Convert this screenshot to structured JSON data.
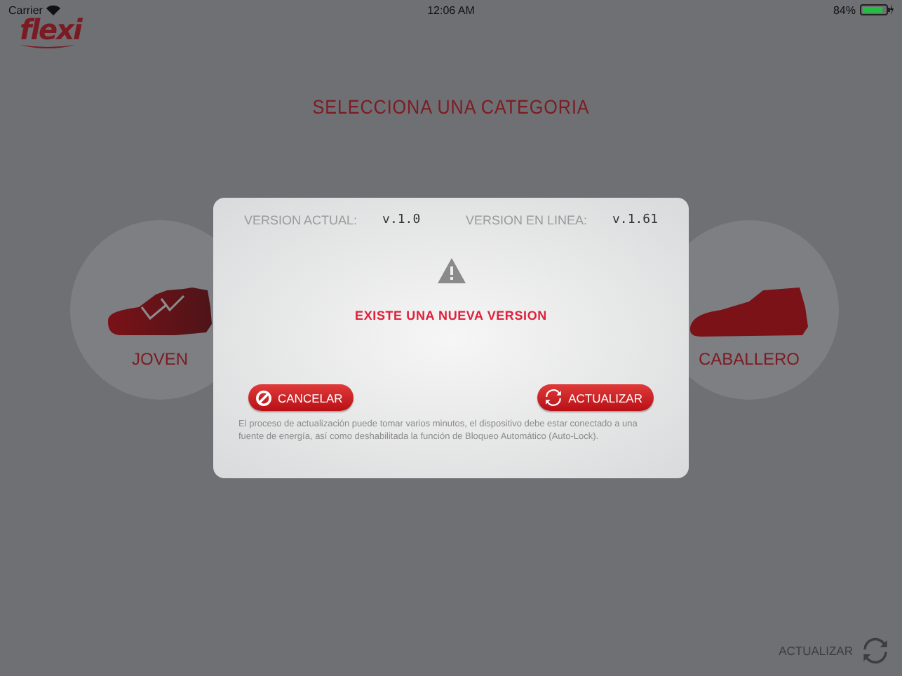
{
  "status_bar": {
    "carrier": "Carrier",
    "time": "12:06 AM",
    "battery": "84%"
  },
  "logo": "flexi",
  "heading": "SELECCIONA UNA CATEGORIA",
  "categories": [
    {
      "kind": "sneaker",
      "label": "JOVEN"
    },
    {
      "kind": "dress",
      "label": "CABALLERO"
    }
  ],
  "dialog": {
    "current_label": "VERSION ACTUAL:",
    "current_value": "v.1.0",
    "online_label": "VERSION EN LINEA:",
    "online_value": "v.1.61",
    "message": "EXISTE UNA NUEVA VERSION",
    "buttons": [
      {
        "kind": "cancel",
        "label": "CANCELAR"
      },
      {
        "kind": "update",
        "label": "ACTUALIZAR"
      }
    ],
    "note": "El proceso de actualización puede tomar varios minutos, el dispositivo debe estar conectado a una fuente de energía, así como deshabilitada la función de Bloqueo Automático (Auto-Lock)."
  },
  "footer": {
    "update_label": "ACTUALIZAR"
  }
}
